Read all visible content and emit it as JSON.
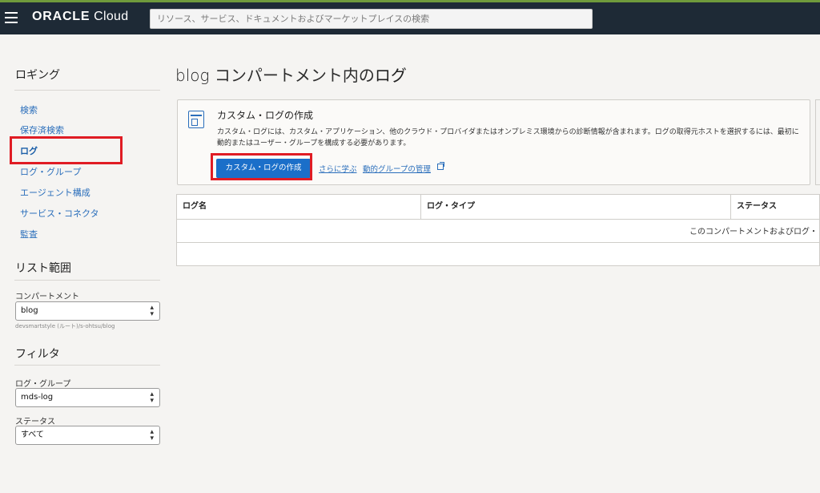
{
  "header": {
    "brand_bold": "ORACLE",
    "brand_light": "Cloud",
    "search_placeholder": "リソース、サービス、ドキュメントおよびマーケットプレイスの検索"
  },
  "sidebar": {
    "title": "ロギング",
    "nav": [
      {
        "label": "検索"
      },
      {
        "label": "保存済検索"
      },
      {
        "label": "ログ",
        "active": true
      },
      {
        "label": "ログ・グループ"
      },
      {
        "label": "エージェント構成"
      },
      {
        "label": "サービス・コネクタ"
      },
      {
        "label": "監査"
      }
    ],
    "scope_title": "リスト範囲",
    "compartment_label": "コンパートメント",
    "compartment_value": "blog",
    "compartment_path": "devsmartstyle (ルート)/s-ohtsu/blog",
    "filter_title": "フィルタ",
    "log_group_label": "ログ・グループ",
    "log_group_value": "mds-log",
    "status_label": "ステータス",
    "status_value": "すべて"
  },
  "main": {
    "title_prefix": "blog",
    "title_middle": "コンパートメント内の",
    "title_suffix": "ログ",
    "card": {
      "title": "カスタム・ログの作成",
      "description": "カスタム・ログには、カスタム・アプリケーション、他のクラウド・プロバイダまたはオンプレミス環境からの診断情報が含まれます。ログの取得元ホストを選択するには、最初に動的またはユーザー・グループを構成する必要があります。",
      "button": "カスタム・ログの作成",
      "learn_more": "さらに学ぶ",
      "manage_groups": "動的グループの管理"
    },
    "table": {
      "columns": [
        "ログ名",
        "ログ・タイプ",
        "ステータス"
      ],
      "empty_message": "このコンパートメントおよびログ・"
    }
  },
  "colors": {
    "header_bg": "#1e2a36",
    "accent_blue": "#1b6fc9",
    "link_blue": "#2a6ebb",
    "highlight_red": "#e01c24"
  }
}
